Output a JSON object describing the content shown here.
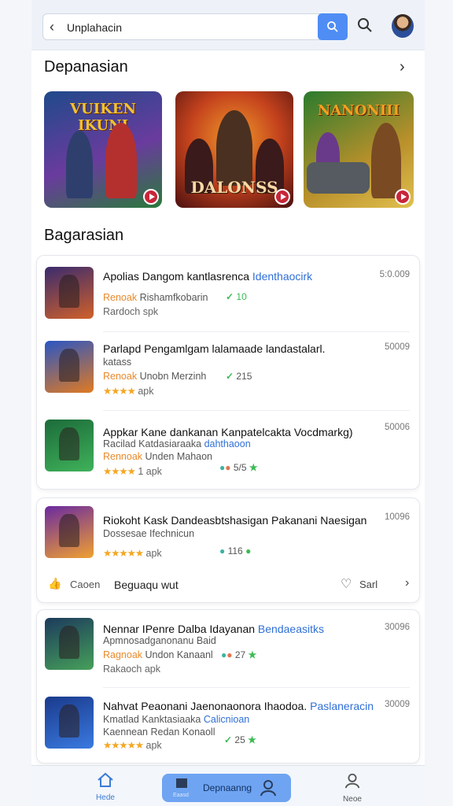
{
  "search": {
    "query": "Unplahacin"
  },
  "section1": {
    "title": "Depanasian"
  },
  "banners": [
    {
      "title": "VUIKEN IKUNI",
      "small": "",
      "colors": [
        "#1f4a8a",
        "#6a3b9e",
        "#2a7a3a"
      ]
    },
    {
      "title": "DALONSS",
      "small": "",
      "colors": [
        "#6b1515",
        "#c4421d",
        "#f09a2a"
      ]
    },
    {
      "title": "NANONIII",
      "small": "",
      "colors": [
        "#2a7b2d",
        "#b9902b",
        "#e0c050"
      ]
    }
  ],
  "section2": {
    "title": "Bagarasian"
  },
  "card1": [
    {
      "title": "Apolias Dangom kantlasrenca",
      "title_hl": "Identhaocirk",
      "tag": "Renoak",
      "sub": "Rishamfkobarin",
      "check": "✓",
      "badge": "10",
      "line3": "Rardoch",
      "line3b": "spk",
      "count": "5:0.009",
      "colors": [
        "#3a2b6e",
        "#d0602a"
      ]
    },
    {
      "title": "Parlapd Pengamlgam lalamaade landastalarl.",
      "title2": "katass",
      "tag": "Renoak",
      "sub": "Unobn Merzinh",
      "check": "✓",
      "badge": "215",
      "stars": "★★★★",
      "line3b": "apk",
      "count": "50009",
      "colors": [
        "#2a56c4",
        "#e07a22"
      ]
    },
    {
      "title": "Appkar Kane dankanan Kanpatelcakta Vocdmarkg)",
      "sub_a": "Racilad Katdasiaraaka",
      "sub_hl": "dahthaoon",
      "tag": "Rennoak",
      "sub": "Unden Mahaon",
      "stars": "★★★★",
      "line3b": "1 apk",
      "badge": "5/5",
      "count": "50006",
      "colors": [
        "#1c6b3a",
        "#3fb25a"
      ]
    }
  ],
  "card2": {
    "row": {
      "title": "Riokoht Kask Dandeasbtshasigan Pakanani Naesigan",
      "sub": "Dossesae Ifechnicun",
      "stars": "★★★★★",
      "line3b": "apk",
      "badge": "116",
      "count": "10096",
      "colors": [
        "#6a2aa0",
        "#f0a030"
      ]
    },
    "like": {
      "icon": "👍",
      "label": "Caoen",
      "main": "Beguaqu wut",
      "save": "Sarl"
    }
  },
  "card3": [
    {
      "title": "Nennar IPenre Dalba Idayanan",
      "title_hl": "Bendaeasitks",
      "sub": "Apmnosadganonanu Baid",
      "tag": "Ragnoak",
      "sub2": "Undon Kanaanl",
      "badge": "27",
      "line3": "Rakaoch",
      "line3b": "apk",
      "count": "30096",
      "colors": [
        "#1c3a5c",
        "#46a05a"
      ]
    },
    {
      "title": "Nahvat Peaonani Jaenonaonora Ihaodoa.",
      "title_hl": "Paslaneracin",
      "sub": "Kmatlad Kanktasiaaka",
      "sub_hl": "Calicnioan",
      "tag": "",
      "sub2": "Kaennean Redan Konaoll",
      "stars": "★★★★★",
      "line3b": "apk",
      "badge": "25",
      "count": "30009",
      "colors": [
        "#1a3a8c",
        "#3a7ae0"
      ]
    }
  ],
  "nav": {
    "home": "Hede",
    "pill_small": "Eaasd",
    "pill": "Depnaanng",
    "news": "Neoe"
  }
}
